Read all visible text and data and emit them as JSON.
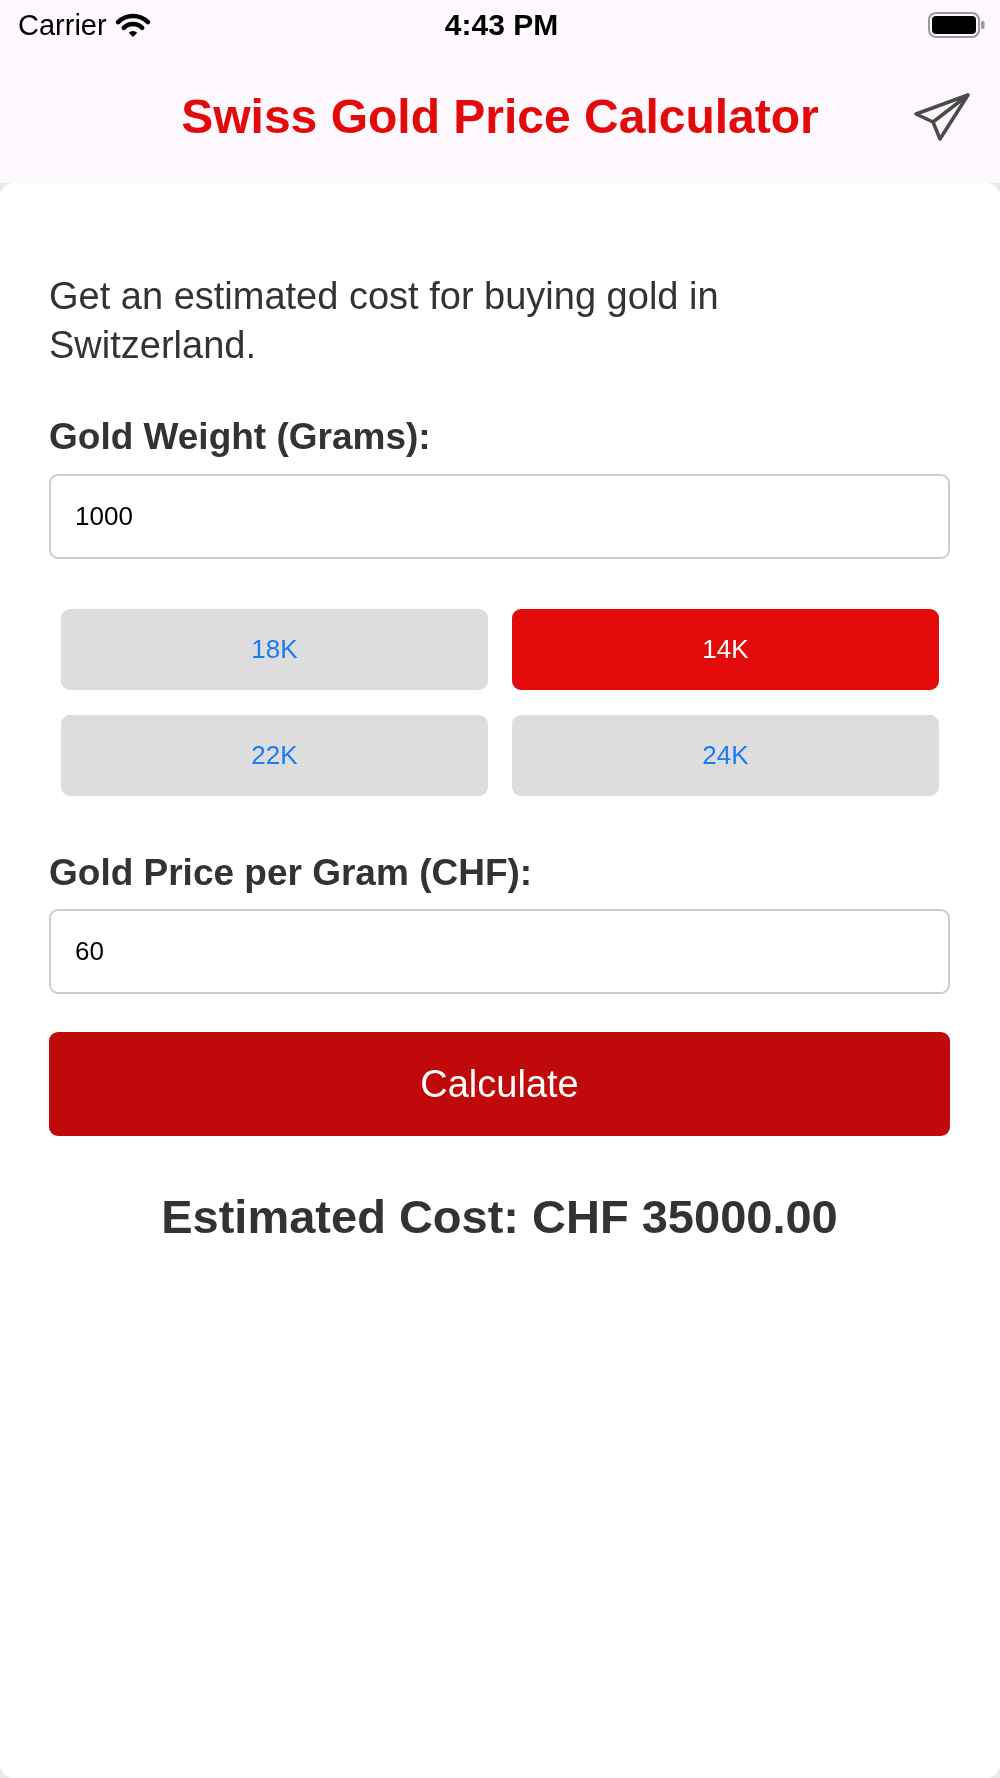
{
  "status_bar": {
    "carrier": "Carrier",
    "time": "4:43 PM"
  },
  "header": {
    "title": "Swiss Gold Price Calculator"
  },
  "intro": "Get an estimated cost for buying gold in Switzerland.",
  "weight_field": {
    "label": "Gold Weight (Grams):",
    "value": "1000"
  },
  "karat_options": [
    {
      "label": "18K",
      "selected": false
    },
    {
      "label": "14K",
      "selected": true
    },
    {
      "label": "22K",
      "selected": false
    },
    {
      "label": "24K",
      "selected": false
    }
  ],
  "price_field": {
    "label": "Gold Price per Gram (CHF):",
    "value": "60"
  },
  "calculate_button": {
    "label": "Calculate"
  },
  "result": "Estimated Cost: CHF 35000.00"
}
